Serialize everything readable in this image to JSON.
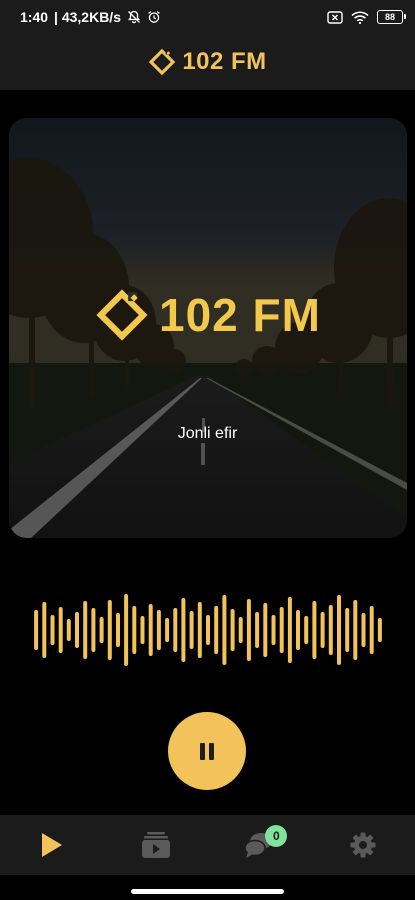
{
  "status_bar": {
    "time": "1:40",
    "network_speed": "| 43,2KB/s",
    "battery_level": "88",
    "icons": [
      "bell-off-icon",
      "alarm-icon",
      "sim-x-icon",
      "wifi-icon",
      "battery-icon"
    ]
  },
  "header": {
    "brand": "102 FM",
    "logo_icon": "diamond-logo-icon"
  },
  "hero": {
    "brand": "102 FM",
    "subtitle": "Jonli efir"
  },
  "player": {
    "state": "playing",
    "control_icon": "pause-icon"
  },
  "bottom_nav": {
    "items": [
      {
        "name": "play",
        "icon": "play-icon",
        "active": true
      },
      {
        "name": "videos",
        "icon": "video-library-icon",
        "active": false
      },
      {
        "name": "chat",
        "icon": "chat-bubbles-icon",
        "active": false,
        "badge": "0"
      },
      {
        "name": "settings",
        "icon": "gear-icon",
        "active": false
      }
    ]
  },
  "colors": {
    "accent": "#f2c35a",
    "badge": "#7fe39a",
    "bar_bg": "#1b1b1b",
    "inactive_icon": "#5a5a5a"
  }
}
